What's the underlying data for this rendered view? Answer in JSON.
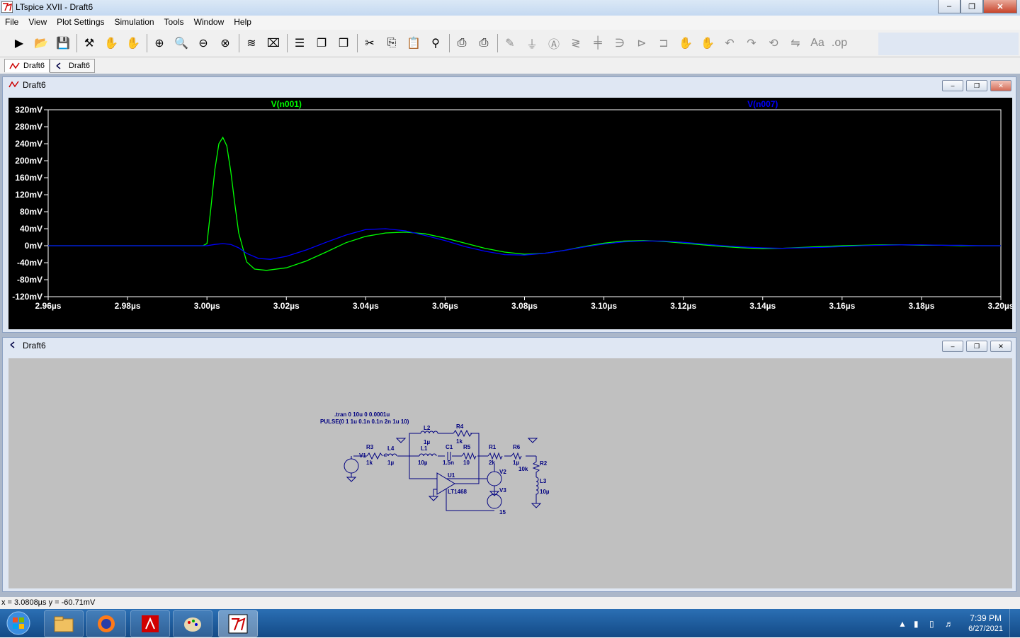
{
  "app": {
    "title": "LTspice XVII - Draft6"
  },
  "menu": {
    "items": [
      "File",
      "View",
      "Plot Settings",
      "Simulation",
      "Tools",
      "Window",
      "Help"
    ]
  },
  "toolbar": {
    "buttons": [
      "run-icon",
      "open-icon",
      "save-icon",
      "control-panel-icon",
      "halt-icon",
      "pan-icon",
      "zoom-in-icon",
      "zoom-rect-icon",
      "zoom-out-icon",
      "zoom-cancel-icon",
      "autorange-icon",
      "mark-icon",
      "tile-horizontal-icon",
      "cascade-icon",
      "tile-vertical-icon",
      "cut-icon",
      "copy-icon",
      "paste-icon",
      "find-icon",
      "print-icon",
      "print-setup-icon",
      "wire-icon",
      "ground-icon",
      "label-icon",
      "resistor-icon",
      "capacitor-icon",
      "inductor-icon",
      "diode-icon",
      "component-icon",
      "move-icon",
      "drag-icon",
      "undo-icon",
      "redo-icon",
      "rotate-icon",
      "mirror-icon",
      "text-icon",
      "spice-directive-icon"
    ]
  },
  "doc_tabs": [
    {
      "label": "Draft6",
      "kind": "waveform"
    },
    {
      "label": "Draft6",
      "kind": "schematic"
    }
  ],
  "plot_window": {
    "title": "Draft6"
  },
  "schematic_window": {
    "title": "Draft6"
  },
  "chart_data": {
    "type": "line",
    "title": "",
    "xlabel": "",
    "ylabel": "",
    "xlim": [
      2.96,
      3.2
    ],
    "ylim": [
      -120,
      320
    ],
    "x_ticks": [
      "2.96µs",
      "2.98µs",
      "3.00µs",
      "3.02µs",
      "3.04µs",
      "3.06µs",
      "3.08µs",
      "3.10µs",
      "3.12µs",
      "3.14µs",
      "3.16µs",
      "3.18µs",
      "3.20µs"
    ],
    "y_ticks": [
      "320mV",
      "280mV",
      "240mV",
      "200mV",
      "160mV",
      "120mV",
      "80mV",
      "40mV",
      "0mV",
      "-40mV",
      "-80mV",
      "-120mV"
    ],
    "x_unit": "µs",
    "y_unit": "mV",
    "series": [
      {
        "name": "V(n001)",
        "color": "#00ff00",
        "x": [
          2.96,
          2.99,
          2.999,
          3.0,
          3.001,
          3.002,
          3.003,
          3.004,
          3.005,
          3.006,
          3.007,
          3.008,
          3.01,
          3.012,
          3.015,
          3.02,
          3.025,
          3.03,
          3.035,
          3.04,
          3.045,
          3.05,
          3.055,
          3.06,
          3.065,
          3.07,
          3.075,
          3.08,
          3.085,
          3.09,
          3.095,
          3.1,
          3.105,
          3.11,
          3.115,
          3.12,
          3.125,
          3.13,
          3.135,
          3.14,
          3.145,
          3.15,
          3.155,
          3.16,
          3.165,
          3.17,
          3.175,
          3.18,
          3.185,
          3.19,
          3.195,
          3.2
        ],
        "y": [
          0,
          0,
          0,
          5,
          90,
          180,
          240,
          255,
          235,
          175,
          100,
          30,
          -38,
          -55,
          -58,
          -52,
          -36,
          -15,
          7,
          22,
          30,
          32,
          28,
          18,
          6,
          -6,
          -15,
          -20,
          -18,
          -11,
          -2,
          6,
          11,
          12,
          10,
          6,
          2,
          -2,
          -5,
          -7,
          -6,
          -4,
          -2,
          0,
          1,
          2,
          2,
          1,
          1,
          0,
          0,
          0
        ]
      },
      {
        "name": "V(n007)",
        "color": "#0000ff",
        "x": [
          2.96,
          2.99,
          3.0,
          3.002,
          3.004,
          3.006,
          3.008,
          3.01,
          3.013,
          3.016,
          3.02,
          3.025,
          3.03,
          3.035,
          3.04,
          3.045,
          3.05,
          3.055,
          3.06,
          3.065,
          3.07,
          3.075,
          3.08,
          3.085,
          3.09,
          3.095,
          3.1,
          3.105,
          3.11,
          3.115,
          3.12,
          3.125,
          3.13,
          3.135,
          3.14,
          3.145,
          3.15,
          3.155,
          3.16,
          3.165,
          3.17,
          3.175,
          3.18,
          3.185,
          3.19,
          3.195,
          3.2
        ],
        "y": [
          0,
          0,
          0,
          3,
          5,
          3,
          -5,
          -18,
          -30,
          -32,
          -25,
          -10,
          8,
          25,
          38,
          40,
          35,
          24,
          12,
          -2,
          -13,
          -21,
          -22,
          -18,
          -11,
          -3,
          4,
          9,
          11,
          11,
          8,
          4,
          0,
          -3,
          -5,
          -6,
          -5,
          -4,
          -2,
          0,
          1,
          2,
          2,
          1,
          1,
          0,
          0
        ]
      }
    ]
  },
  "schematic": {
    "directives": [
      ".tran 0 10u 0 0.0001u",
      "PULSE(0 1 1u 0.1n 0.1n 2n 1u 10)"
    ],
    "components": [
      {
        "ref": "V1",
        "value": ""
      },
      {
        "ref": "R3",
        "value": "1k"
      },
      {
        "ref": "L4",
        "value": "1µ"
      },
      {
        "ref": "L2",
        "value": "1µ"
      },
      {
        "ref": "R4",
        "value": "1k"
      },
      {
        "ref": "L1",
        "value": "10µ"
      },
      {
        "ref": "C1",
        "value": "1.5n"
      },
      {
        "ref": "R5",
        "value": "10"
      },
      {
        "ref": "R1",
        "value": "2k"
      },
      {
        "ref": "R6",
        "value": "1µ"
      },
      {
        "ref": "R2",
        "value": "10k"
      },
      {
        "ref": "L3",
        "value": "10µ"
      },
      {
        "ref": "U1",
        "value": "LT1468"
      },
      {
        "ref": "V2",
        "value": ""
      },
      {
        "ref": "V3",
        "value": "15"
      }
    ]
  },
  "status": {
    "text": "x = 3.0808µs   y = -60.71mV"
  },
  "taskbar": {
    "apps": [
      "explorer-icon",
      "firefox-icon",
      "acrobat-icon",
      "paint-icon",
      "ltspice-icon"
    ],
    "clock_time": "7:39 PM",
    "clock_date": "6/27/2021"
  }
}
